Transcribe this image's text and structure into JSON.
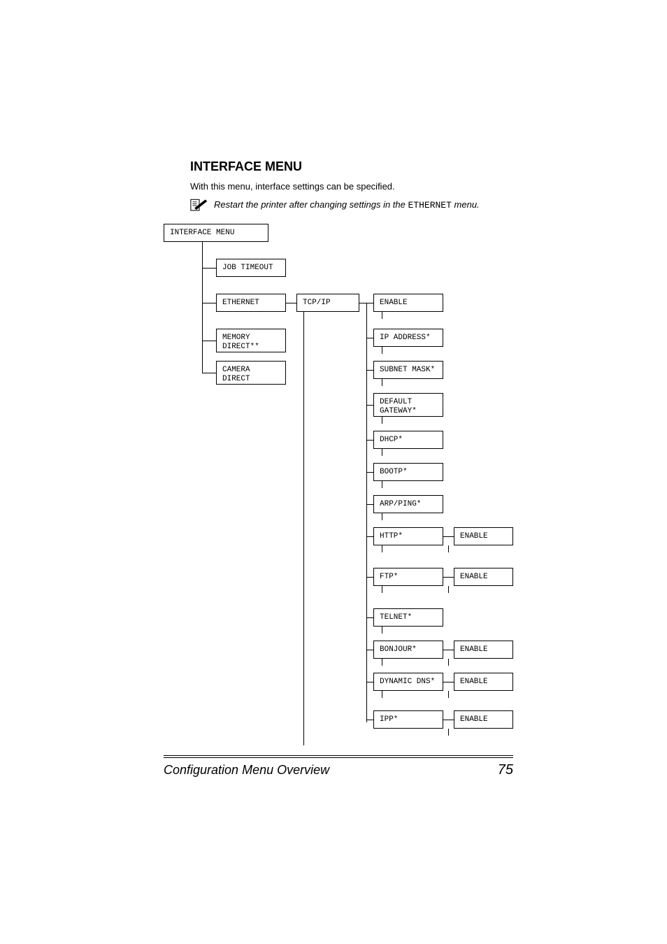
{
  "heading": "INTERFACE MENU",
  "intro": "With this menu, interface settings can be specified.",
  "note_prefix": "Restart the printer after changing settings in the ",
  "note_mono": "ETHERNET",
  "note_suffix": " menu.",
  "footer_title": "Configuration Menu Overview",
  "footer_page": "75",
  "boxes": {
    "root": "INTERFACE MENU",
    "job_timeout": "JOB TIMEOUT",
    "ethernet": "ETHERNET",
    "memory_direct": "MEMORY\nDIRECT**",
    "camera_direct": "CAMERA\nDIRECT",
    "tcpip": "TCP/IP",
    "enable": "ENABLE",
    "ip_address": "IP ADDRESS*",
    "subnet_mask": "SUBNET MASK*",
    "default_gateway": "DEFAULT\nGATEWAY*",
    "dhcp": "DHCP*",
    "bootp": "BOOTP*",
    "arp_ping": "ARP/PING*",
    "http": "HTTP*",
    "ftp": "FTP*",
    "telnet": "TELNET*",
    "bonjour": "BONJOUR*",
    "dynamic_dns": "DYNAMIC DNS*",
    "ipp": "IPP*",
    "enable_http": "ENABLE",
    "enable_ftp": "ENABLE",
    "enable_bonjour": "ENABLE",
    "enable_ddns": "ENABLE",
    "enable_ipp": "ENABLE"
  }
}
